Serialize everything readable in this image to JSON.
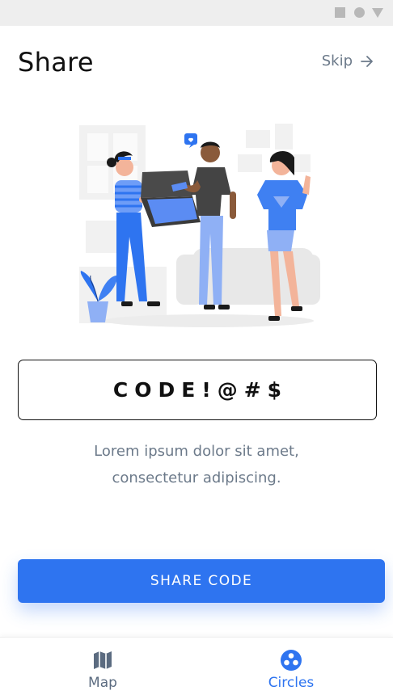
{
  "header": {
    "title": "Share",
    "skip_label": "Skip"
  },
  "illustration": {
    "description_icon": "people-sharing-pizza-illustration"
  },
  "code": {
    "value": "CODE!@#$"
  },
  "description": {
    "line1": "Lorem ipsum dolor sit amet,",
    "line2": "consectetur adipiscing."
  },
  "actions": {
    "share_label": "SHARE CODE"
  },
  "bottom_nav": {
    "items": [
      {
        "label": "Map",
        "icon": "map-icon",
        "active": false
      },
      {
        "label": "Circles",
        "icon": "circles-icon",
        "active": true
      }
    ]
  },
  "colors": {
    "accent": "#2e74f0",
    "muted_text": "#6c7a8a",
    "status_bar": "#eeeeee"
  }
}
